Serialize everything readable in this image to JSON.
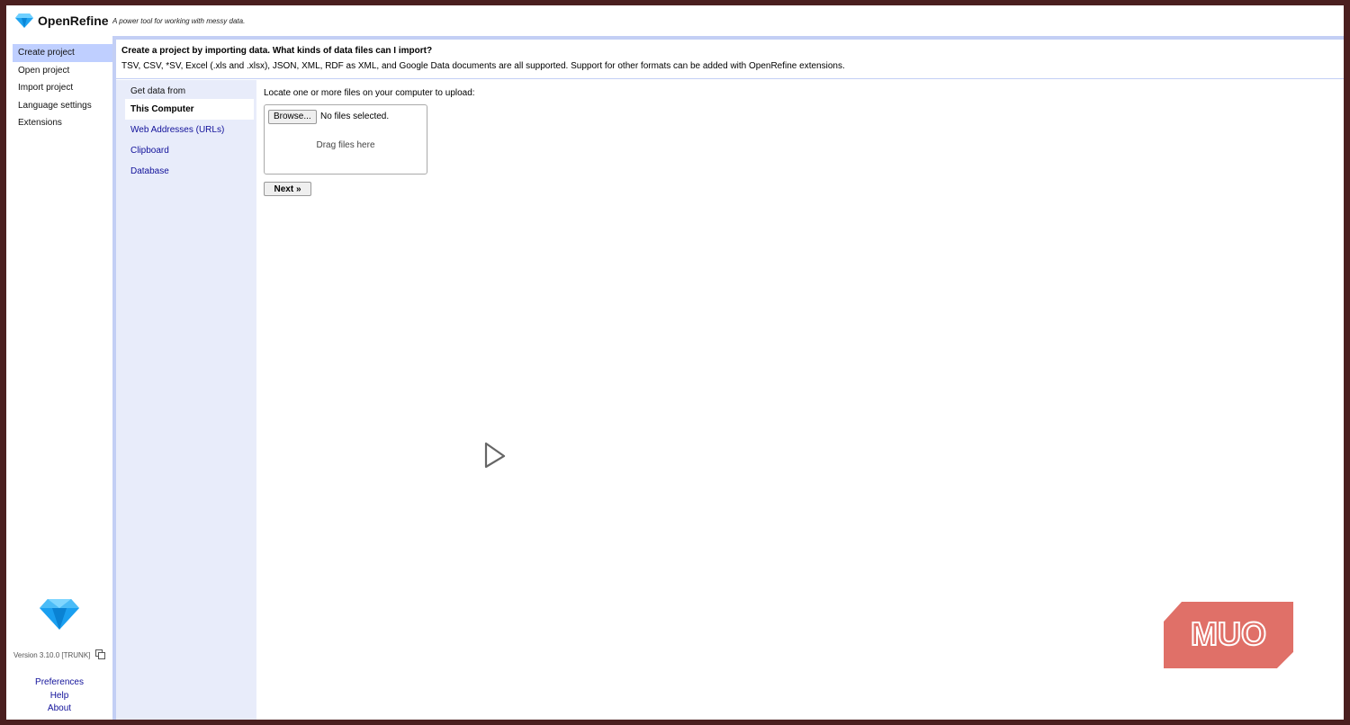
{
  "header": {
    "app_name": "OpenRefine",
    "tagline": "A power tool for working with messy data."
  },
  "leftnav": {
    "items": [
      {
        "label": "Create project",
        "selected": true
      },
      {
        "label": "Open project"
      },
      {
        "label": "Import project"
      },
      {
        "label": "Language settings"
      },
      {
        "label": "Extensions"
      }
    ],
    "version": "Version 3.10.0 [TRUNK]",
    "bottom_links": [
      "Preferences",
      "Help",
      "About"
    ]
  },
  "intro": {
    "title": "Create a project by importing data.",
    "help_link": "What kinds of data files can I import?",
    "description": "TSV, CSV, *SV, Excel (.xls and .xlsx), JSON, XML, RDF as XML, and Google Data documents are all supported. Support for other formats can be added with OpenRefine extensions."
  },
  "sources": {
    "heading": "Get data from",
    "tabs": [
      "This Computer",
      "Web Addresses (URLs)",
      "Clipboard",
      "Database"
    ],
    "selected": "This Computer"
  },
  "upload": {
    "label": "Locate one or more files on your computer to upload:",
    "browse_label": "Browse...",
    "no_files": "No files selected.",
    "drag_hint": "Drag files here",
    "next_label": "Next »"
  },
  "watermark": {
    "text": "MUO",
    "color": "#e07068"
  },
  "colors": {
    "nav_selected": "#bfcfff",
    "panel_border": "#c3cff5",
    "sources_bg": "#e8ecfa",
    "link": "#11119a"
  }
}
